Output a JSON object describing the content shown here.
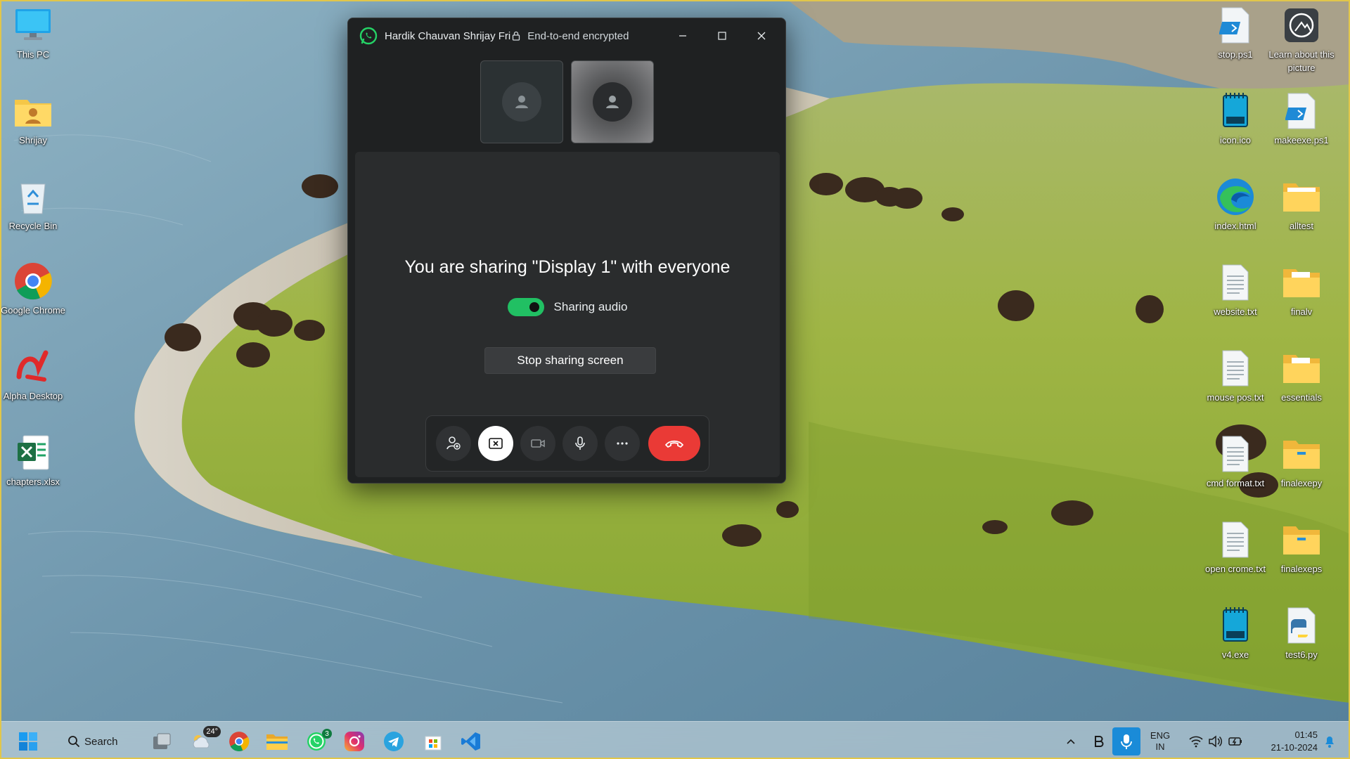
{
  "desktop": {
    "left_icons": [
      {
        "label": "This PC",
        "icon": "monitor-icon"
      },
      {
        "label": "Shrijay",
        "icon": "user-folder-icon"
      },
      {
        "label": "Recycle Bin",
        "icon": "recycle-bin-icon"
      },
      {
        "label": "Google Chrome",
        "icon": "chrome-icon"
      },
      {
        "label": "Alpha Desktop",
        "icon": "alpha-icon"
      },
      {
        "label": "chapters.xlsx",
        "icon": "excel-icon"
      }
    ],
    "right_icons_col1": [
      {
        "label": "stop.ps1",
        "icon": "powershell-file-icon"
      },
      {
        "label": "icon.ico",
        "icon": "ico-file-icon"
      },
      {
        "label": "index.html",
        "icon": "edge-icon"
      },
      {
        "label": "website.txt",
        "icon": "text-file-icon"
      },
      {
        "label": "mouse pos.txt",
        "icon": "text-file-icon"
      },
      {
        "label": "cmd format.txt",
        "icon": "text-file-icon"
      },
      {
        "label": "open crome.txt",
        "icon": "text-file-icon"
      },
      {
        "label": "v4.exe",
        "icon": "exe-file-icon"
      }
    ],
    "right_icons_col2": [
      {
        "label": "Learn about this picture",
        "icon": "learn-picture-icon"
      },
      {
        "label": "makeexe.ps1",
        "icon": "powershell-file-icon"
      },
      {
        "label": "alltest",
        "icon": "folder-icon"
      },
      {
        "label": "finalv",
        "icon": "folder-icon"
      },
      {
        "label": "essentials",
        "icon": "folder-icon"
      },
      {
        "label": "finalexepy",
        "icon": "folder-icon"
      },
      {
        "label": "finalexeps",
        "icon": "folder-icon"
      },
      {
        "label": "test6.py",
        "icon": "python-file-icon"
      }
    ]
  },
  "call_window": {
    "title": "Hardik Chauvan Shrijay Fri",
    "encryption_text": "End-to-end encrypted",
    "share_message": "You are sharing \"Display 1\" with everyone",
    "audio_label": "Sharing audio",
    "audio_on": true,
    "stop_button_label": "Stop sharing screen",
    "colors": {
      "accent": "#21c063",
      "end_call": "#ea3a36",
      "background": "#1f2122"
    }
  },
  "taskbar": {
    "search_label": "Search",
    "weather_temp": "24°",
    "whatsapp_badge": "3",
    "language_line1": "ENG",
    "language_line2": "IN",
    "time": "01:45",
    "date": "21-10-2024"
  }
}
